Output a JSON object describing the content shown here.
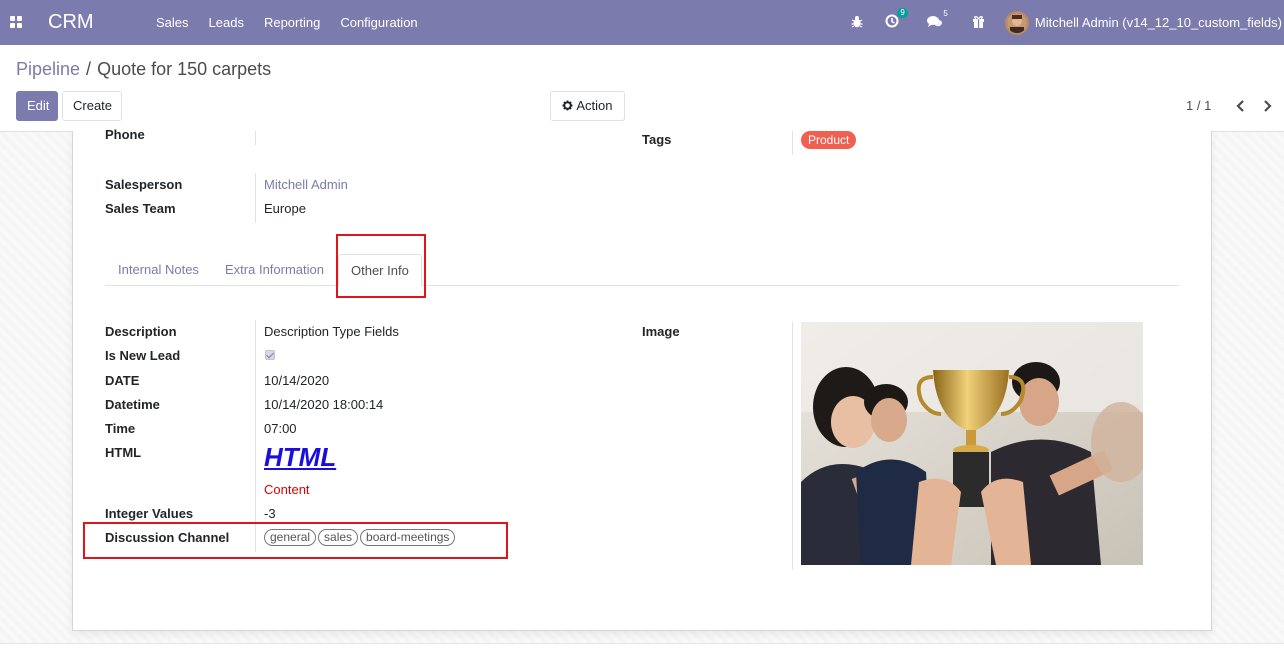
{
  "navbar": {
    "brand": "CRM",
    "menu": [
      "Sales",
      "Leads",
      "Reporting",
      "Configuration"
    ],
    "activity_count": "9",
    "messages_count": "5",
    "user_name": "Mitchell Admin (v14_12_10_custom_fields)"
  },
  "control_panel": {
    "breadcrumb_parent": "Pipeline",
    "breadcrumb_sep": "/",
    "breadcrumb_current": "Quote for 150 carpets",
    "edit_label": "Edit",
    "create_label": "Create",
    "action_label": "Action",
    "pager": "1 / 1"
  },
  "form": {
    "phone_label": "Phone",
    "tags_label": "Tags",
    "tags": [
      "Product"
    ],
    "salesperson_label": "Salesperson",
    "salesperson_value": "Mitchell Admin",
    "sales_team_label": "Sales Team",
    "sales_team_value": "Europe"
  },
  "tabs": [
    "Internal Notes",
    "Extra Information",
    "Other Info"
  ],
  "active_tab": "Other Info",
  "other_info": {
    "description_label": "Description",
    "description_value": "Description Type Fields",
    "is_new_lead_label": "Is New Lead",
    "is_new_lead_value": true,
    "date_label": "DATE",
    "date_value": "10/14/2020",
    "datetime_label": "Datetime",
    "datetime_value": "10/14/2020 18:00:14",
    "time_label": "Time",
    "time_value": "07:00",
    "html_label": "HTML",
    "html_heading": "HTML",
    "html_content": "Content",
    "integer_label": "Integer Values",
    "integer_value": "-3",
    "discussion_label": "Discussion Channel",
    "discussion_channels": [
      "general",
      "sales",
      "board-meetings"
    ],
    "image_label": "Image"
  },
  "colors": {
    "brand": "#7c7bad",
    "tag_product": "#f06050",
    "highlight_box": "#e0151b",
    "html_link": "#1a0ddd",
    "html_content": "#e00000"
  },
  "icons": [
    "apps-icon",
    "bug-icon",
    "activity-icon",
    "chat-icon",
    "gift-icon",
    "gear-icon",
    "chevron-left-icon",
    "chevron-right-icon"
  ]
}
